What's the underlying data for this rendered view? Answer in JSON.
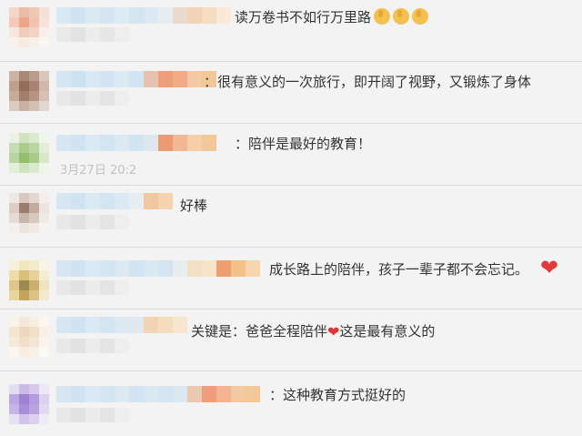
{
  "comments": [
    {
      "text": "读万卷书不如行万里路",
      "suffix_icons": [
        "thumbs-up-icon",
        "thumbs-up-icon",
        "thumbs-up-icon"
      ]
    },
    {
      "text": "：很有意义的一次旅行，即开阔了视野，又锻炼了身体"
    },
    {
      "text": "：陪伴是最好的教育！"
    },
    {
      "text": "好棒"
    },
    {
      "text": "成长路上的陪伴，孩子一辈子都不会忘记。",
      "suffix_icons": [
        "red-heart-icon"
      ]
    },
    {
      "text_before": "关键是：爸爸全程陪伴",
      "text_after": "这是最有意义的",
      "inline_icon": "red-heart-icon"
    },
    {
      "text": "：这种教育方式挺好的"
    }
  ],
  "partial_timestamp": "3月27日 20:2",
  "colors": {
    "background": "#f3f3f3",
    "divider": "#dcdcdc",
    "heart": "#e03a3a",
    "thumb": "#f2c14e"
  }
}
